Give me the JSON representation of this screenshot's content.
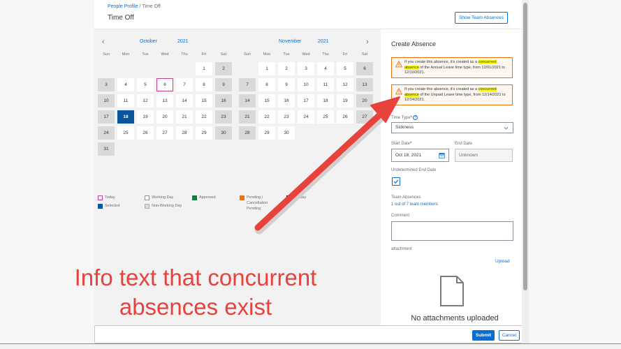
{
  "breadcrumb": {
    "link": "People Profile",
    "separator": "/",
    "current": "Time Off"
  },
  "page_title": "Time Off",
  "show_team_button": "Show Team Absences",
  "calendar": {
    "prev_arrow": "‹",
    "next_arrow": "›",
    "weekdays": [
      "Sun",
      "Mon",
      "Tue",
      "Wed",
      "Thu",
      "Fri",
      "Sat"
    ],
    "months": [
      {
        "month": "October",
        "year": "2021",
        "days": [
          {
            "d": "",
            "t": "blank"
          },
          {
            "d": "",
            "t": "blank"
          },
          {
            "d": "",
            "t": "blank"
          },
          {
            "d": "",
            "t": "blank"
          },
          {
            "d": "",
            "t": "blank"
          },
          {
            "d": "1",
            "t": "working"
          },
          {
            "d": "2",
            "t": "nonworking"
          },
          {
            "d": "3",
            "t": "nonworking"
          },
          {
            "d": "4",
            "t": "working"
          },
          {
            "d": "5",
            "t": "working"
          },
          {
            "d": "6",
            "t": "today"
          },
          {
            "d": "7",
            "t": "working"
          },
          {
            "d": "8",
            "t": "working"
          },
          {
            "d": "9",
            "t": "nonworking"
          },
          {
            "d": "10",
            "t": "nonworking"
          },
          {
            "d": "11",
            "t": "working"
          },
          {
            "d": "12",
            "t": "working"
          },
          {
            "d": "13",
            "t": "working"
          },
          {
            "d": "14",
            "t": "working"
          },
          {
            "d": "15",
            "t": "working"
          },
          {
            "d": "16",
            "t": "nonworking"
          },
          {
            "d": "17",
            "t": "nonworking"
          },
          {
            "d": "18",
            "t": "selected"
          },
          {
            "d": "19",
            "t": "working"
          },
          {
            "d": "20",
            "t": "working"
          },
          {
            "d": "21",
            "t": "working"
          },
          {
            "d": "22",
            "t": "working"
          },
          {
            "d": "23",
            "t": "nonworking"
          },
          {
            "d": "24",
            "t": "nonworking"
          },
          {
            "d": "25",
            "t": "working"
          },
          {
            "d": "26",
            "t": "working"
          },
          {
            "d": "27",
            "t": "working"
          },
          {
            "d": "28",
            "t": "working"
          },
          {
            "d": "29",
            "t": "working"
          },
          {
            "d": "30",
            "t": "nonworking"
          },
          {
            "d": "31",
            "t": "nonworking"
          }
        ]
      },
      {
        "month": "November",
        "year": "2021",
        "days": [
          {
            "d": "",
            "t": "blank"
          },
          {
            "d": "1",
            "t": "working"
          },
          {
            "d": "2",
            "t": "working"
          },
          {
            "d": "3",
            "t": "working"
          },
          {
            "d": "4",
            "t": "working"
          },
          {
            "d": "5",
            "t": "working"
          },
          {
            "d": "6",
            "t": "nonworking"
          },
          {
            "d": "7",
            "t": "nonworking"
          },
          {
            "d": "8",
            "t": "working"
          },
          {
            "d": "9",
            "t": "working"
          },
          {
            "d": "10",
            "t": "working"
          },
          {
            "d": "11",
            "t": "working"
          },
          {
            "d": "12",
            "t": "working"
          },
          {
            "d": "13",
            "t": "nonworking"
          },
          {
            "d": "14",
            "t": "nonworking"
          },
          {
            "d": "15",
            "t": "working"
          },
          {
            "d": "16",
            "t": "working"
          },
          {
            "d": "17",
            "t": "working"
          },
          {
            "d": "18",
            "t": "working"
          },
          {
            "d": "19",
            "t": "working"
          },
          {
            "d": "20",
            "t": "nonworking"
          },
          {
            "d": "21",
            "t": "nonworking"
          },
          {
            "d": "22",
            "t": "working"
          },
          {
            "d": "23",
            "t": "working"
          },
          {
            "d": "24",
            "t": "working"
          },
          {
            "d": "25",
            "t": "working"
          },
          {
            "d": "26",
            "t": "working"
          },
          {
            "d": "27",
            "t": "nonworking"
          },
          {
            "d": "28",
            "t": "nonworking"
          },
          {
            "d": "29",
            "t": "working"
          },
          {
            "d": "30",
            "t": "working"
          }
        ]
      }
    ]
  },
  "legend": {
    "today": "Today",
    "selected": "Selected",
    "working_day": "Working Day",
    "non_working_day": "Non-Working Day",
    "approved": "Approved",
    "pending_1": "Pending /",
    "pending_2": "Cancellation",
    "pending_3": "Pending",
    "holiday": "Holiday",
    "colors": {
      "today": "#c2438d",
      "selected": "#0a54a0",
      "approved": "#107e3e",
      "pending": "#e9730c",
      "holiday": "#000000",
      "nonworking": "#d9d9d9"
    }
  },
  "panel": {
    "title": "Create Absence",
    "warning1": {
      "pre": "If you create this absence, it's created as a",
      "highlight": "concurrent absence",
      "post": "of the Annual Leave time type, from 12/01/2021 to 12/10/2021."
    },
    "warning2": {
      "pre": "If you create this absence, it's created as a",
      "highlight": "concurrent absence",
      "post": "of the Unpaid Leave time type, from 12/14/2021 to 12/14/2021."
    },
    "time_type_label": "Time Type",
    "required_mark": "*",
    "help_glyph": "?",
    "time_type_value": "Sickness",
    "start_date_label": "Start Date",
    "start_date_value": "Oct 18, 2021",
    "end_date_label": "End Date",
    "end_date_value": "Unknown",
    "undetermined_label": "Undetermined End Date",
    "team_absences_label": "Team Absences",
    "team_absences_link": "1 out of 7 team members",
    "comment_label": "Comment",
    "attachment_label": "attachment",
    "upload_link": "Upload",
    "no_attachments": "No attachments uploaded"
  },
  "footer": {
    "submit": "Submit",
    "cancel": "Cancel"
  },
  "annotation": {
    "line1": "Info text that concurrent",
    "line2": "absences exist",
    "color": "#e8423d"
  }
}
